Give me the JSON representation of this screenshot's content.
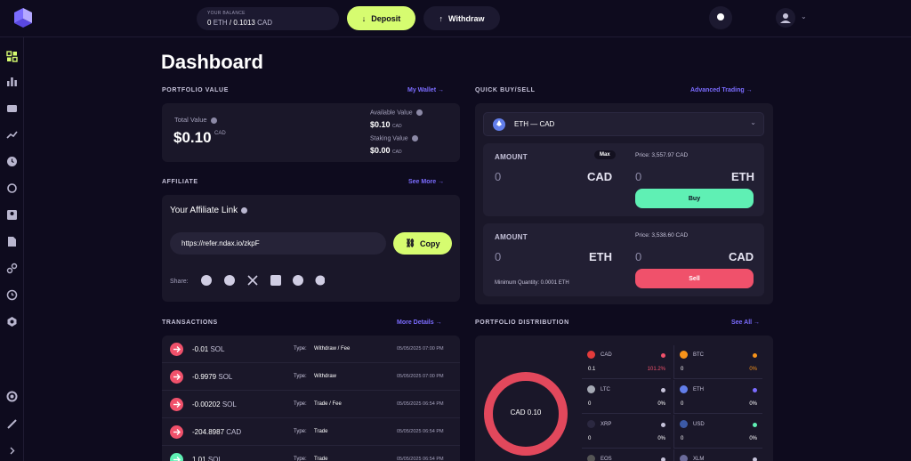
{
  "header": {
    "balance_label": "YOUR BALANCE",
    "balance_eth": "0",
    "balance_eth_unit": "ETH",
    "balance_sep": "/",
    "balance_cad": "0.1013",
    "balance_cad_unit": "CAD",
    "deposit_label": "Deposit",
    "withdraw_label": "Withdraw"
  },
  "sidebar": {
    "icons": [
      "dashboard-icon",
      "bar-chart-icon",
      "wallet-icon",
      "trend-icon",
      "clock-icon",
      "refresh-icon",
      "id-card-icon",
      "document-icon",
      "link-icon",
      "history-icon",
      "settings-icon",
      "support-icon",
      "edit-icon",
      "chevron-right-icon"
    ]
  },
  "page_title": "Dashboard",
  "portfolio": {
    "title": "PORTFOLIO VALUE",
    "link": "My Wallet",
    "total_label": "Total Value",
    "total_value": "$0.10",
    "total_unit": "CAD",
    "available_label": "Available Value",
    "available_value": "$0.10",
    "available_unit": "CAD",
    "staking_label": "Staking Value",
    "staking_value": "$0.00",
    "staking_unit": "CAD"
  },
  "affiliate": {
    "title": "AFFILIATE",
    "link": "See More",
    "heading": "Your Affiliate Link",
    "url": "https://refer.ndax.io/zkpF",
    "copy_label": "Copy",
    "share_label": "Share:",
    "share_icons": [
      "reddit-icon",
      "facebook-icon",
      "x-icon",
      "linkedin-icon",
      "telegram-icon",
      "whatsapp-icon"
    ]
  },
  "quick": {
    "title": "QUICK BUY/SELL",
    "link": "Advanced Trading",
    "pair": "ETH — CAD",
    "buy": {
      "amount_label": "AMOUNT",
      "max_label": "Max",
      "amount_value": "0",
      "amount_unit": "CAD",
      "price": "Price: 3,557.97 CAD",
      "receive_value": "0",
      "receive_unit": "ETH",
      "button": "Buy"
    },
    "sell": {
      "amount_label": "AMOUNT",
      "amount_value": "0",
      "amount_unit": "ETH",
      "price": "Price: 3,538.60 CAD",
      "receive_value": "0",
      "receive_unit": "CAD",
      "min_qty": "Minimum Quantity: 0.0001 ETH",
      "button": "Sell"
    }
  },
  "transactions": {
    "title": "TRANSACTIONS",
    "link": "More Details",
    "type_label": "Type:",
    "rows": [
      {
        "amount": "-0.01",
        "unit": "SOL",
        "type": "Withdraw / Fee",
        "date": "05/05/2025 07:00 PM",
        "color": "#f0516b"
      },
      {
        "amount": "-0.9979",
        "unit": "SOL",
        "type": "Withdraw",
        "date": "05/05/2025 07:00 PM",
        "color": "#f0516b"
      },
      {
        "amount": "-0.00202",
        "unit": "SOL",
        "type": "Trade / Fee",
        "date": "05/05/2025 06:54 PM",
        "color": "#f0516b"
      },
      {
        "amount": "-204.8987",
        "unit": "CAD",
        "type": "Trade",
        "date": "05/05/2025 06:54 PM",
        "color": "#f0516b"
      },
      {
        "amount": "1.01",
        "unit": "SOL",
        "type": "Trade",
        "date": "05/05/2025 06:54 PM",
        "color": "#5ff0b4"
      }
    ]
  },
  "distribution": {
    "title": "PORTFOLIO DISTRIBUTION",
    "link": "See All",
    "donut_label": "CAD 0.10",
    "coins": [
      {
        "name": "CAD",
        "amount": "0.1",
        "pct": "101.2%",
        "dot": "#f0516b",
        "coin_color": "#e33b3b",
        "pct_color": "#f0516b"
      },
      {
        "name": "BTC",
        "amount": "0",
        "pct": "0%",
        "dot": "#f7931a",
        "coin_color": "#f7931a",
        "pct_color": "#f7931a"
      },
      {
        "name": "LTC",
        "amount": "0",
        "pct": "0%",
        "dot": "#c6c3da",
        "coin_color": "#a5a9b4",
        "pct_color": "#ffffff"
      },
      {
        "name": "ETH",
        "amount": "0",
        "pct": "0%",
        "dot": "#7b6cff",
        "coin_color": "#627eea",
        "pct_color": "#ffffff"
      },
      {
        "name": "XRP",
        "amount": "0",
        "pct": "0%",
        "dot": "#c6c3da",
        "coin_color": "#2b2840",
        "pct_color": "#ffffff"
      },
      {
        "name": "USD",
        "amount": "0",
        "pct": "0%",
        "dot": "#5ff0b4",
        "coin_color": "#3c5aa6",
        "pct_color": "#ffffff"
      },
      {
        "name": "EOS",
        "amount": "",
        "pct": "",
        "dot": "#c6c3da",
        "coin_color": "#555",
        "pct_color": "#ffffff"
      },
      {
        "name": "XLM",
        "amount": "",
        "pct": "",
        "dot": "#c6c3da",
        "coin_color": "#6a6a9a",
        "pct_color": "#ffffff"
      }
    ]
  },
  "colors": {
    "accent_green": "#d6fc70",
    "accent_purple": "#7b6cff",
    "buy_green": "#5ff0b4",
    "sell_red": "#f0516b"
  }
}
